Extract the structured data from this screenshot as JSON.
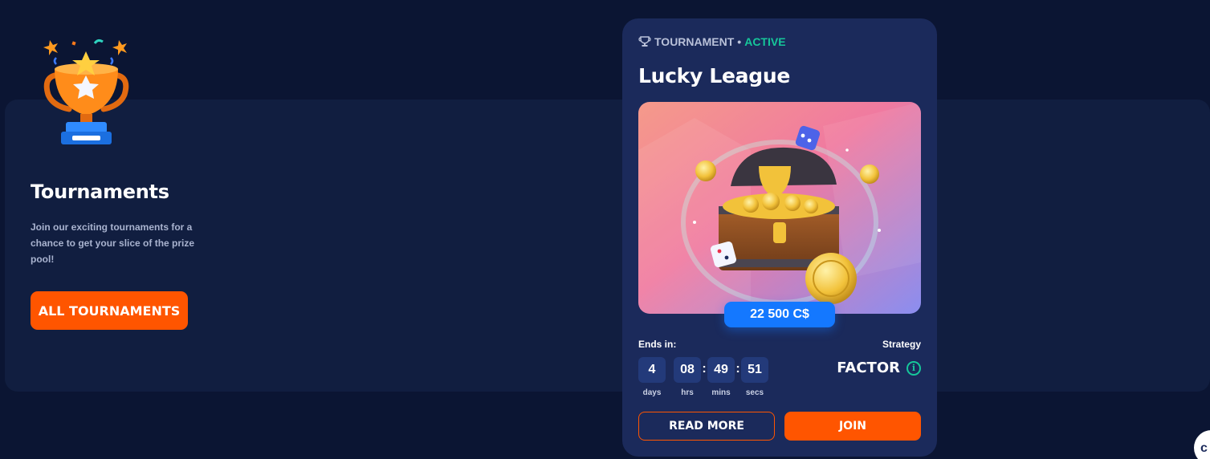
{
  "promo": {
    "title": "Tournaments",
    "description": "Join our exciting tournaments for a chance to get your slice of the prize pool!",
    "button_label": "ALL TOURNAMENTS"
  },
  "card": {
    "tag_label": "TOURNAMENT",
    "tag_separator": "•",
    "status": "ACTIVE",
    "title": "Lucky League",
    "prize": "22 500 C$",
    "ends_label": "Ends in:",
    "timer": {
      "days": "4",
      "days_label": "days",
      "hrs": "08",
      "hrs_label": "hrs",
      "mins": "49",
      "mins_label": "mins",
      "secs": "51",
      "secs_label": "secs",
      "separator": ":"
    },
    "strategy_label": "Strategy",
    "strategy_value": "FACTOR",
    "read_more_label": "READ MORE",
    "join_label": "JOIN"
  },
  "colors": {
    "background": "#0b1533",
    "panel": "#111e40",
    "card": "#1b2a5b",
    "accent_orange": "#ff5500",
    "accent_green": "#16c79a",
    "prize_blue": "#1478ff"
  },
  "icons": {
    "trophy_illustration": "trophy-icon",
    "tag_icon": "trophy-icon",
    "info_icon": "info-icon",
    "chat_icon": "chat-icon"
  }
}
